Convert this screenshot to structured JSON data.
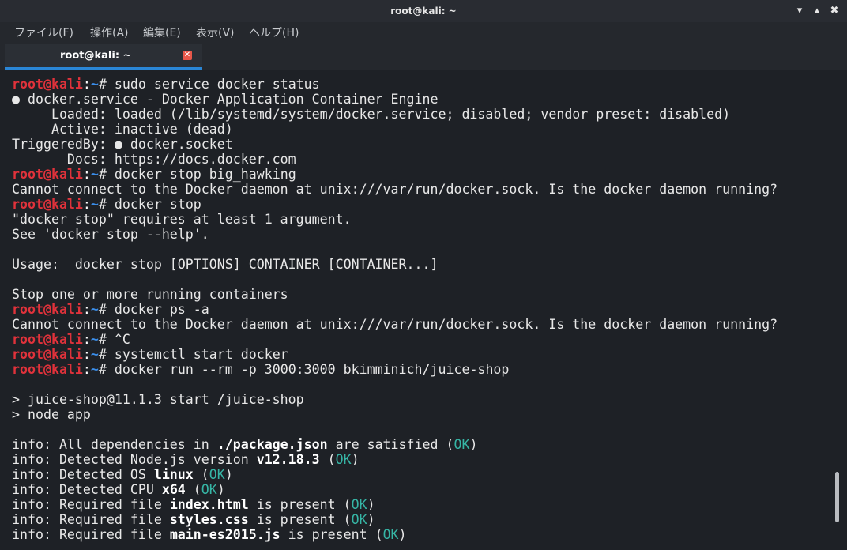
{
  "window": {
    "title": "root@kali: ~",
    "controls": {
      "minimize": "▾",
      "maximize": "▴",
      "restore": "■",
      "close": "✖"
    }
  },
  "menubar": {
    "items": [
      {
        "label": "ファイル(F)"
      },
      {
        "label": "操作(A)"
      },
      {
        "label": "編集(E)"
      },
      {
        "label": "表示(V)"
      },
      {
        "label": "ヘルプ(H)"
      }
    ]
  },
  "tabs": [
    {
      "label": "root@kali: ~",
      "close_icon": "close-icon",
      "active": true
    }
  ],
  "colors": {
    "prompt_user": "#e0323b",
    "prompt_path": "#3b8eea",
    "ok": "#36b5a5",
    "text": "#e8e8e8",
    "tab_accent": "#2a86d6"
  },
  "terminal": {
    "lines": [
      [
        {
          "t": "root@kali",
          "s": "prompt-user"
        },
        {
          "t": ":",
          "s": "prompt-sep"
        },
        {
          "t": "~",
          "s": "prompt-path"
        },
        {
          "t": "# sudo service docker status",
          "s": "plain"
        }
      ],
      [
        {
          "t": "● docker.service - Docker Application Container Engine",
          "s": "plain"
        }
      ],
      [
        {
          "t": "     Loaded: loaded (/lib/systemd/system/docker.service; disabled; vendor preset: disabled)",
          "s": "plain"
        }
      ],
      [
        {
          "t": "     Active: inactive (dead)",
          "s": "plain"
        }
      ],
      [
        {
          "t": "TriggeredBy: ● docker.socket",
          "s": "plain"
        }
      ],
      [
        {
          "t": "       Docs: https://docs.docker.com",
          "s": "plain"
        }
      ],
      [
        {
          "t": "root@kali",
          "s": "prompt-user"
        },
        {
          "t": ":",
          "s": "prompt-sep"
        },
        {
          "t": "~",
          "s": "prompt-path"
        },
        {
          "t": "# docker stop big_hawking",
          "s": "plain"
        }
      ],
      [
        {
          "t": "Cannot connect to the Docker daemon at unix:///var/run/docker.sock. Is the docker daemon running?",
          "s": "plain"
        }
      ],
      [
        {
          "t": "root@kali",
          "s": "prompt-user"
        },
        {
          "t": ":",
          "s": "prompt-sep"
        },
        {
          "t": "~",
          "s": "prompt-path"
        },
        {
          "t": "# docker stop",
          "s": "plain"
        }
      ],
      [
        {
          "t": "\"docker stop\" requires at least 1 argument.",
          "s": "plain"
        }
      ],
      [
        {
          "t": "See 'docker stop --help'.",
          "s": "plain"
        }
      ],
      [],
      [
        {
          "t": "Usage:  docker stop [OPTIONS] CONTAINER [CONTAINER...]",
          "s": "plain"
        }
      ],
      [],
      [
        {
          "t": "Stop one or more running containers",
          "s": "plain"
        }
      ],
      [
        {
          "t": "root@kali",
          "s": "prompt-user"
        },
        {
          "t": ":",
          "s": "prompt-sep"
        },
        {
          "t": "~",
          "s": "prompt-path"
        },
        {
          "t": "# docker ps -a",
          "s": "plain"
        }
      ],
      [
        {
          "t": "Cannot connect to the Docker daemon at unix:///var/run/docker.sock. Is the docker daemon running?",
          "s": "plain"
        }
      ],
      [
        {
          "t": "root@kali",
          "s": "prompt-user"
        },
        {
          "t": ":",
          "s": "prompt-sep"
        },
        {
          "t": "~",
          "s": "prompt-path"
        },
        {
          "t": "# ^C",
          "s": "plain"
        }
      ],
      [
        {
          "t": "root@kali",
          "s": "prompt-user"
        },
        {
          "t": ":",
          "s": "prompt-sep"
        },
        {
          "t": "~",
          "s": "prompt-path"
        },
        {
          "t": "# systemctl start docker",
          "s": "plain"
        }
      ],
      [
        {
          "t": "root@kali",
          "s": "prompt-user"
        },
        {
          "t": ":",
          "s": "prompt-sep"
        },
        {
          "t": "~",
          "s": "prompt-path"
        },
        {
          "t": "# docker run --rm -p 3000:3000 bkimminich/juice-shop",
          "s": "plain"
        }
      ],
      [],
      [
        {
          "t": "> juice-shop@11.1.3 start /juice-shop",
          "s": "plain"
        }
      ],
      [
        {
          "t": "> node app",
          "s": "plain"
        }
      ],
      [],
      [
        {
          "t": "info: All dependencies in ",
          "s": "plain"
        },
        {
          "t": "./package.json",
          "s": "bold"
        },
        {
          "t": " are satisfied (",
          "s": "plain"
        },
        {
          "t": "OK",
          "s": "ok"
        },
        {
          "t": ")",
          "s": "plain"
        }
      ],
      [
        {
          "t": "info: Detected Node.js version ",
          "s": "plain"
        },
        {
          "t": "v12.18.3",
          "s": "bold"
        },
        {
          "t": " (",
          "s": "plain"
        },
        {
          "t": "OK",
          "s": "ok"
        },
        {
          "t": ")",
          "s": "plain"
        }
      ],
      [
        {
          "t": "info: Detected OS ",
          "s": "plain"
        },
        {
          "t": "linux",
          "s": "bold"
        },
        {
          "t": " (",
          "s": "plain"
        },
        {
          "t": "OK",
          "s": "ok"
        },
        {
          "t": ")",
          "s": "plain"
        }
      ],
      [
        {
          "t": "info: Detected CPU ",
          "s": "plain"
        },
        {
          "t": "x64",
          "s": "bold"
        },
        {
          "t": " (",
          "s": "plain"
        },
        {
          "t": "OK",
          "s": "ok"
        },
        {
          "t": ")",
          "s": "plain"
        }
      ],
      [
        {
          "t": "info: Required file ",
          "s": "plain"
        },
        {
          "t": "index.html",
          "s": "bold"
        },
        {
          "t": " is present (",
          "s": "plain"
        },
        {
          "t": "OK",
          "s": "ok"
        },
        {
          "t": ")",
          "s": "plain"
        }
      ],
      [
        {
          "t": "info: Required file ",
          "s": "plain"
        },
        {
          "t": "styles.css",
          "s": "bold"
        },
        {
          "t": " is present (",
          "s": "plain"
        },
        {
          "t": "OK",
          "s": "ok"
        },
        {
          "t": ")",
          "s": "plain"
        }
      ],
      [
        {
          "t": "info: Required file ",
          "s": "plain"
        },
        {
          "t": "main-es2015.js",
          "s": "bold"
        },
        {
          "t": " is present (",
          "s": "plain"
        },
        {
          "t": "OK",
          "s": "ok"
        },
        {
          "t": ")",
          "s": "plain"
        }
      ]
    ]
  }
}
